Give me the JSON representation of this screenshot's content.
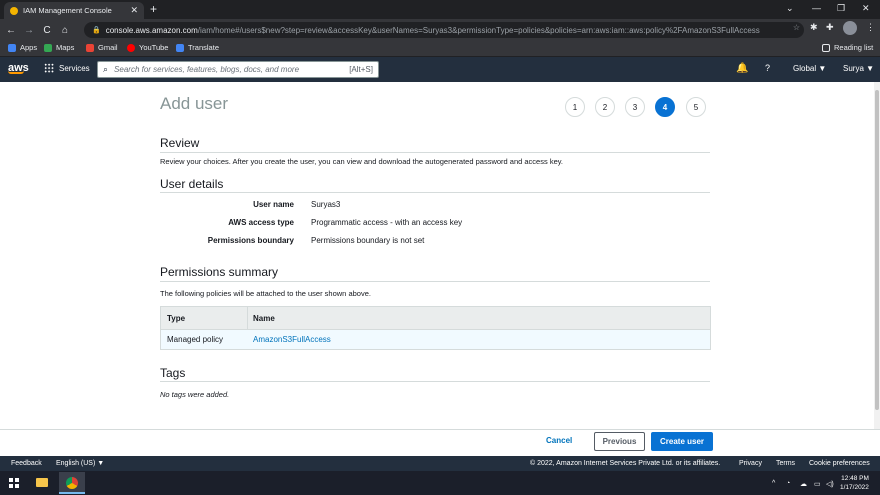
{
  "browser": {
    "tab_title": "IAM Management Console",
    "tab_close": "✕",
    "new_tab": "+",
    "url_domain": "console.aws.amazon.com",
    "url_path": "/iam/home#/users$new?step=review&accessKey&userNames=Suryas3&permissionType=policies&policies=arn:aws:iam::aws:policy%2FAmazonS3FullAccess",
    "bookmarks": [
      "Apps",
      "Maps",
      "Gmail",
      "YouTube",
      "Translate"
    ],
    "reading_list": "Reading list"
  },
  "aws_nav": {
    "logo": "aws",
    "services": "Services",
    "search_placeholder": "Search for services, features, blogs, docs, and more",
    "search_shortcut": "[Alt+S]",
    "region": "Global ▼",
    "user": "Surya ▼"
  },
  "page": {
    "title": "Add user",
    "steps": [
      "1",
      "2",
      "3",
      "4",
      "5"
    ],
    "active_step": 4,
    "review": {
      "heading": "Review",
      "description": "Review your choices. After you create the user, you can view and download the autogenerated password and access key."
    },
    "user_details": {
      "heading": "User details",
      "rows": [
        {
          "label": "User name",
          "value": "Suryas3"
        },
        {
          "label": "AWS access type",
          "value": "Programmatic access - with an access key"
        },
        {
          "label": "Permissions boundary",
          "value": "Permissions boundary is not set"
        }
      ]
    },
    "permissions": {
      "heading": "Permissions summary",
      "description": "The following policies will be attached to the user shown above.",
      "columns": [
        "Type",
        "Name"
      ],
      "rows": [
        {
          "type": "Managed policy",
          "name": "AmazonS3FullAccess"
        }
      ]
    },
    "tags": {
      "heading": "Tags",
      "empty": "No tags were added."
    }
  },
  "actions": {
    "cancel": "Cancel",
    "previous": "Previous",
    "create": "Create user"
  },
  "footer": {
    "feedback": "Feedback",
    "language": "English (US) ▼",
    "copyright": "© 2022, Amazon Internet Services Private Ltd. or its affiliates.",
    "privacy": "Privacy",
    "terms": "Terms",
    "cookies": "Cookie preferences"
  },
  "taskbar": {
    "time": "12:48 PM",
    "date": "1/17/2022"
  }
}
